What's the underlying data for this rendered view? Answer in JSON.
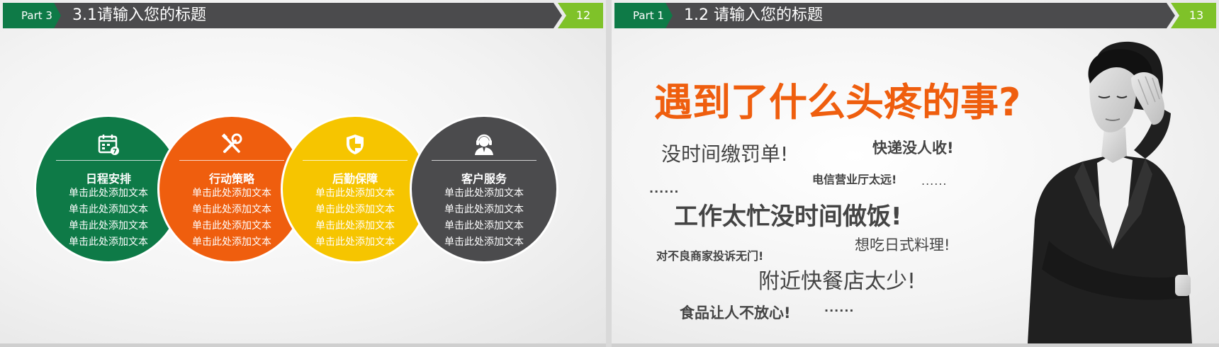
{
  "slide12": {
    "part": "Part 3",
    "title": "3.1请输入您的标题",
    "page_number": "12",
    "circles": [
      {
        "name": "日程安排",
        "icon": "calendar-icon",
        "color": "#0e7a47",
        "lines": [
          "单击此处添加文本",
          "单击此处添加文本",
          "单击此处添加文本",
          "单击此处添加文本"
        ]
      },
      {
        "name": "行动策略",
        "icon": "tools-icon",
        "color": "#ef5e0e",
        "lines": [
          "单击此处添加文本",
          "单击此处添加文本",
          "单击此处添加文本",
          "单击此处添加文本"
        ]
      },
      {
        "name": "后勤保障",
        "icon": "shield-icon",
        "color": "#f6c500",
        "lines": [
          "单击此处添加文本",
          "单击此处添加文本",
          "单击此处添加文本",
          "单击此处添加文本"
        ]
      },
      {
        "name": "客户服务",
        "icon": "headset-agent-icon",
        "color": "#4b4b4d",
        "lines": [
          "单击此处添加文本",
          "单击此处添加文本",
          "单击此处添加文本",
          "单击此处添加文本"
        ]
      }
    ]
  },
  "slide13": {
    "part": "Part 1",
    "title": "1.2 请输入您的标题",
    "page_number": "13",
    "headline": "遇到了什么头疼的事?",
    "headline_color": "#ef5e0e",
    "phrases": {
      "p1": "没时间缴罚单!",
      "p2": "快递没人收!",
      "p3": "电信营业厅太远!",
      "p4": "工作太忙没时间做饭!",
      "p5": "想吃日式料理!",
      "p6": "对不良商家投诉无门!",
      "p7": "附近快餐店太少!",
      "p8": "食品让人不放心!",
      "e1": "......",
      "e2": "......",
      "e3": "......"
    }
  },
  "colors": {
    "green": "#0e7a47",
    "dark_gray": "#4b4b4d",
    "lime": "#7fc229",
    "orange": "#ef5e0e",
    "yellow": "#f6c500"
  }
}
